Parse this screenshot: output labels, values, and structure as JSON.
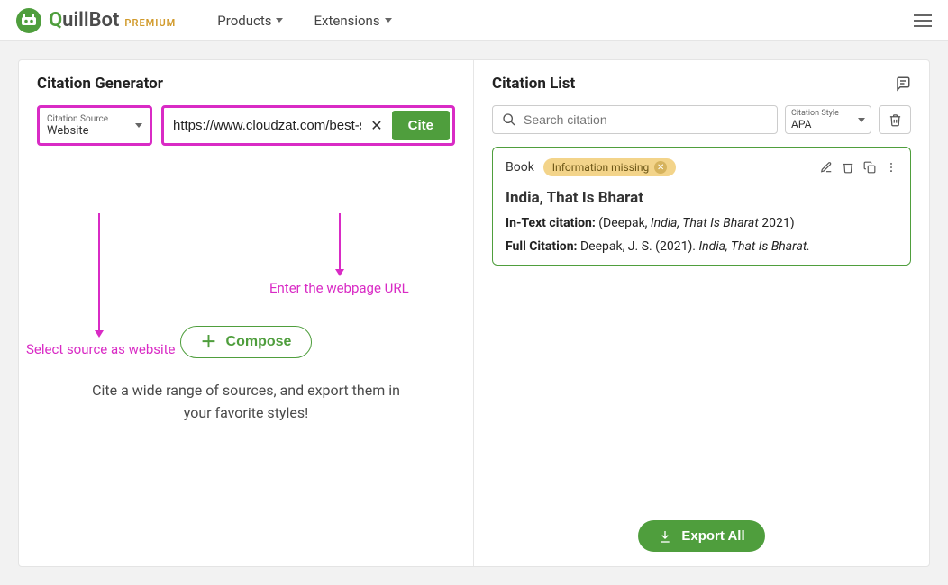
{
  "header": {
    "brand_name": "QuillBot",
    "premium_label": "PREMIUM",
    "nav": {
      "products": "Products",
      "extensions": "Extensions"
    }
  },
  "generator": {
    "title": "Citation Generator",
    "source_label": "Citation Source",
    "source_value": "Website",
    "url_value": "https://www.cloudzat.com/best-su",
    "cite_button": "Cite",
    "compose_button": "Compose",
    "tagline": "Cite a wide range of sources, and export them in your favorite styles!"
  },
  "annotations": {
    "select_source": "Select source as website",
    "enter_url": "Enter the webpage URL"
  },
  "list": {
    "title": "Citation List",
    "search_placeholder": "Search citation",
    "style_label": "Citation Style",
    "style_value": "APA",
    "card": {
      "source_type": "Book",
      "badge": "Information missing",
      "title": "India, That Is Bharat",
      "intext_label": "In-Text citation:",
      "intext_prefix": "(Deepak, ",
      "intext_italic": "India, That Is Bharat",
      "intext_suffix": " 2021)",
      "full_label": "Full Citation:",
      "full_prefix": " Deepak, J. S. (2021). ",
      "full_italic": "India, That Is Bharat."
    },
    "export_button": "Export All"
  }
}
